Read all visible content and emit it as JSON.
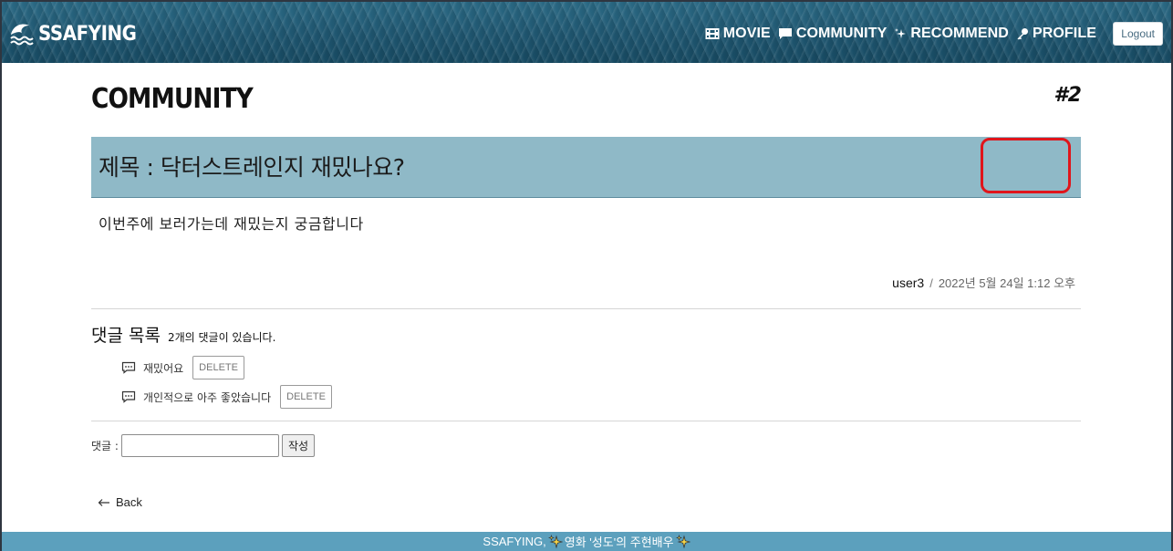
{
  "navbar": {
    "brand": "SSAFYING",
    "links": [
      {
        "label": "MOVIE",
        "icon": "film-icon"
      },
      {
        "label": "COMMUNITY",
        "icon": "chat-icon"
      },
      {
        "label": "RECOMMEND",
        "icon": "sparkle-icon"
      },
      {
        "label": "PROFILE",
        "icon": "key-icon"
      }
    ],
    "logout_label": "Logout"
  },
  "page": {
    "title": "COMMUNITY",
    "post_number": "#2"
  },
  "post": {
    "title": "제목 : 닥터스트레인지 재밌나요?",
    "body": "이번주에 보러가는데 재밌는지 궁금합니다",
    "author": "user3",
    "separator": "/",
    "date": "2022년 5월 24일 1:12 오후"
  },
  "comments": {
    "heading": "댓글 목록",
    "count_text": "2개의 댓글이 있습니다.",
    "items": [
      {
        "text": "재밌어요",
        "delete_label": "DELETE"
      },
      {
        "text": "개인적으로 아주 좋았습니다",
        "delete_label": "DELETE"
      }
    ],
    "form_label": "댓글 :",
    "input_value": "",
    "submit_label": "작성"
  },
  "back_label": "Back",
  "footer": {
    "text_before": "SSAFYING,",
    "text_after": "영화 '성도'의 주현배우"
  },
  "colors": {
    "title_bar": "#8fb9c7",
    "footer": "#5ca0bd",
    "highlight": "#e0151b"
  }
}
